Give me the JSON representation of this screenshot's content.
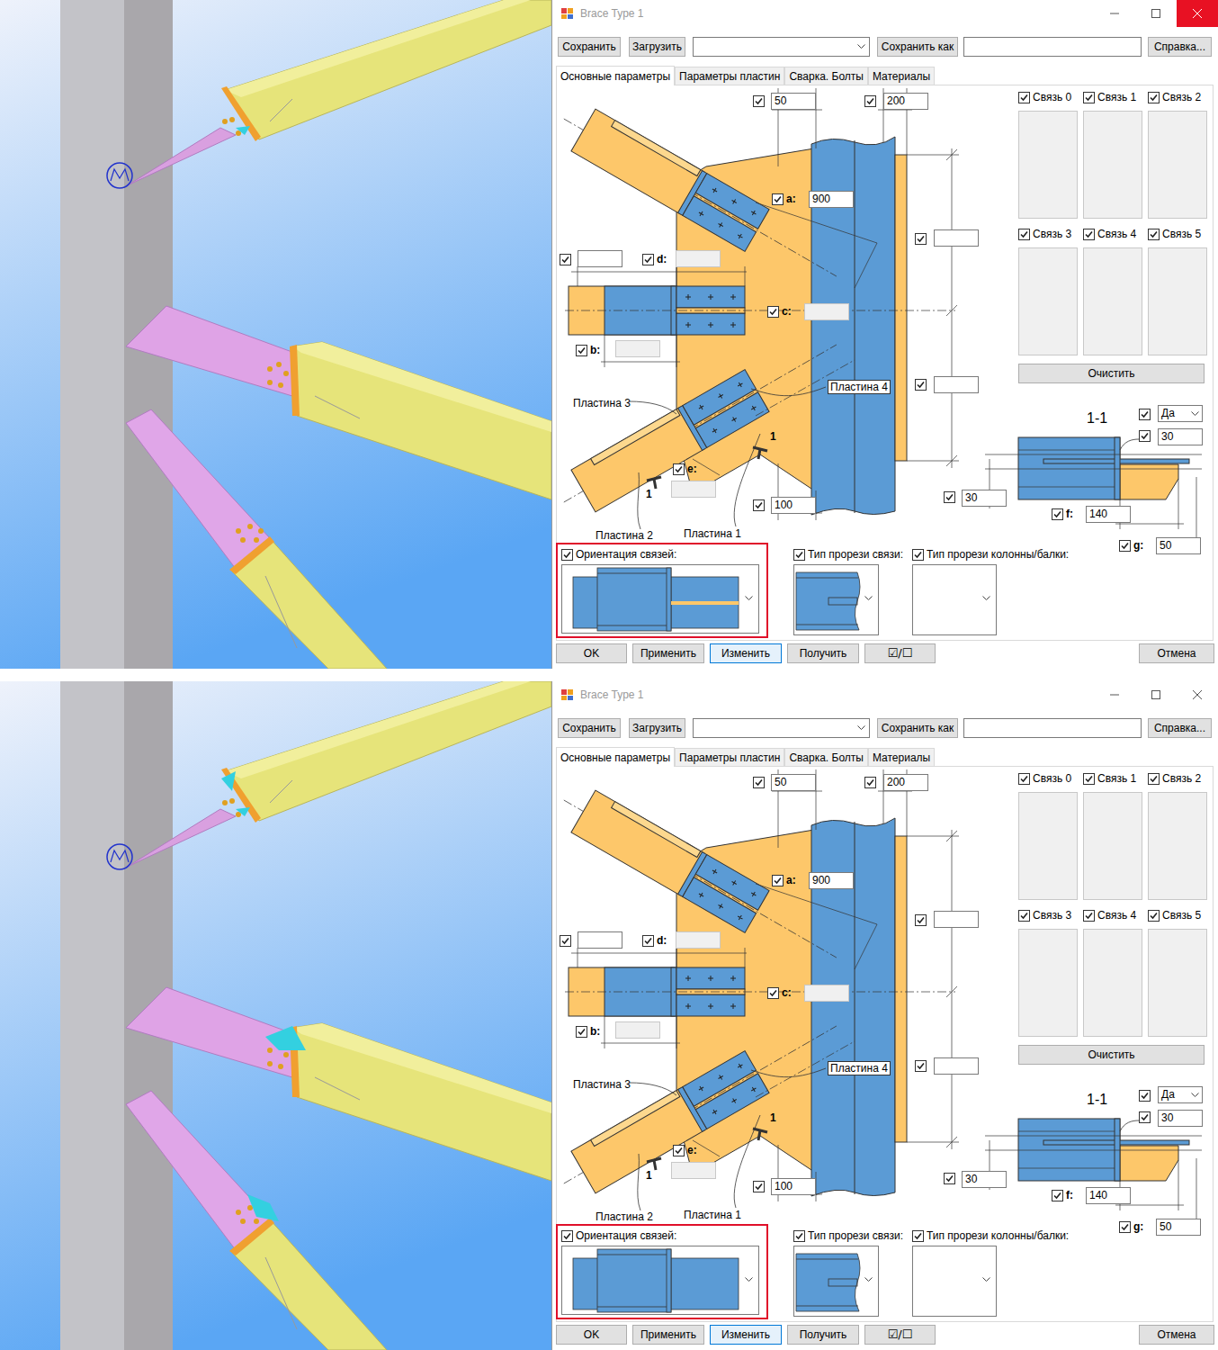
{
  "panels": [
    {
      "window": {
        "title": "Brace Type 1",
        "close_hovered": true
      },
      "toolbar": {
        "save": "Сохранить",
        "load": "Загрузить",
        "preset": "",
        "save_as": "Сохранить как",
        "save_as_name": "",
        "help": "Справка..."
      },
      "tabs": [
        {
          "label": "Основные параметры",
          "selected": true
        },
        {
          "label": "Параметры пластин",
          "selected": false
        },
        {
          "label": "Сварка. Болты",
          "selected": false
        },
        {
          "label": "Материалы",
          "selected": false
        }
      ],
      "fields": [
        {
          "value": "50",
          "checked": true,
          "disabled": false,
          "kind": "input"
        },
        {
          "value": "200",
          "checked": true,
          "disabled": false,
          "kind": "input"
        },
        {
          "label": "a:",
          "value": "900",
          "checked": true,
          "disabled": false,
          "kind": "input"
        },
        {
          "value": "",
          "checked": true,
          "disabled": false,
          "kind": "input"
        },
        {
          "value": "",
          "checked": true,
          "disabled": false,
          "kind": "input"
        },
        {
          "label": "d:",
          "value": "",
          "checked": true,
          "disabled": true,
          "kind": "input"
        },
        {
          "label": "c:",
          "value": "",
          "checked": true,
          "disabled": true,
          "kind": "input"
        },
        {
          "label": "b:",
          "value": "",
          "checked": true,
          "disabled": true,
          "kind": "input"
        },
        {
          "value": "",
          "checked": true,
          "disabled": false,
          "kind": "input"
        },
        {
          "label": "e:",
          "value": "",
          "checked": true,
          "disabled": true,
          "kind": "input"
        },
        {
          "value": "100",
          "checked": true,
          "disabled": false,
          "kind": "input"
        },
        {
          "value": "Да",
          "checked": true,
          "disabled": false,
          "kind": "dropdown"
        },
        {
          "value": "30",
          "checked": true,
          "disabled": false,
          "kind": "input"
        },
        {
          "value": "30",
          "checked": true,
          "disabled": false,
          "kind": "input"
        },
        {
          "label": "f:",
          "value": "140",
          "checked": true,
          "disabled": false,
          "kind": "input"
        },
        {
          "label": "g:",
          "value": "50",
          "checked": true,
          "disabled": false,
          "kind": "input"
        }
      ],
      "plates": [
        "Пластина 3",
        "Пластина 4",
        "Пластина 2",
        "Пластина 1"
      ],
      "section_marks": [
        "1",
        "1"
      ],
      "section_title": "1-1",
      "links": [
        {
          "label": "Связь 0",
          "checked": true
        },
        {
          "label": "Связь 1",
          "checked": true
        },
        {
          "label": "Связь 2",
          "checked": true
        },
        {
          "label": "Связь 3",
          "checked": true
        },
        {
          "label": "Связь 4",
          "checked": true
        },
        {
          "label": "Связь 5",
          "checked": true
        }
      ],
      "clear_button": "Очистить",
      "options": [
        {
          "label": "Ориентация связей:",
          "checked": true,
          "highlighted": true,
          "kind": "orientation"
        },
        {
          "label": "Тип прорези связи:",
          "checked": true,
          "highlighted": false,
          "kind": "brace-slot"
        },
        {
          "label": "Тип прорези колонны/балки:",
          "checked": true,
          "highlighted": false,
          "kind": "column-slot"
        }
      ],
      "orientation_plate_visible": true,
      "view": {
        "cut_pieces_visible": false
      },
      "buttons": [
        {
          "label": "OK",
          "focused": false
        },
        {
          "label": "Применить",
          "focused": false
        },
        {
          "label": "Изменить",
          "focused": true
        },
        {
          "label": "Получить",
          "focused": false
        },
        {
          "label": "☑/☐",
          "focused": false
        },
        {
          "label": "Отмена",
          "focused": false
        }
      ]
    },
    {
      "window": {
        "title": "Brace Type 1",
        "close_hovered": false
      },
      "toolbar": {
        "save": "Сохранить",
        "load": "Загрузить",
        "preset": "",
        "save_as": "Сохранить как",
        "save_as_name": "",
        "help": "Справка..."
      },
      "tabs": [
        {
          "label": "Основные параметры",
          "selected": true
        },
        {
          "label": "Параметры пластин",
          "selected": false
        },
        {
          "label": "Сварка. Болты",
          "selected": false
        },
        {
          "label": "Материалы",
          "selected": false
        }
      ],
      "fields": [
        {
          "value": "50",
          "checked": true,
          "disabled": false,
          "kind": "input"
        },
        {
          "value": "200",
          "checked": true,
          "disabled": false,
          "kind": "input"
        },
        {
          "label": "a:",
          "value": "900",
          "checked": true,
          "disabled": false,
          "kind": "input"
        },
        {
          "value": "",
          "checked": true,
          "disabled": false,
          "kind": "input"
        },
        {
          "value": "",
          "checked": true,
          "disabled": false,
          "kind": "input"
        },
        {
          "label": "d:",
          "value": "",
          "checked": true,
          "disabled": true,
          "kind": "input"
        },
        {
          "label": "c:",
          "value": "",
          "checked": true,
          "disabled": true,
          "kind": "input"
        },
        {
          "label": "b:",
          "value": "",
          "checked": true,
          "disabled": true,
          "kind": "input"
        },
        {
          "value": "",
          "checked": true,
          "disabled": false,
          "kind": "input"
        },
        {
          "label": "e:",
          "value": "",
          "checked": true,
          "disabled": true,
          "kind": "input"
        },
        {
          "value": "100",
          "checked": true,
          "disabled": false,
          "kind": "input"
        },
        {
          "value": "Да",
          "checked": true,
          "disabled": false,
          "kind": "dropdown"
        },
        {
          "value": "30",
          "checked": true,
          "disabled": false,
          "kind": "input"
        },
        {
          "value": "30",
          "checked": true,
          "disabled": false,
          "kind": "input"
        },
        {
          "label": "f:",
          "value": "140",
          "checked": true,
          "disabled": false,
          "kind": "input"
        },
        {
          "label": "g:",
          "value": "50",
          "checked": true,
          "disabled": false,
          "kind": "input"
        }
      ],
      "plates": [
        "Пластина 3",
        "Пластина 4",
        "Пластина 2",
        "Пластина 1"
      ],
      "section_marks": [
        "1",
        "1"
      ],
      "section_title": "1-1",
      "links": [
        {
          "label": "Связь 0",
          "checked": true
        },
        {
          "label": "Связь 1",
          "checked": true
        },
        {
          "label": "Связь 2",
          "checked": true
        },
        {
          "label": "Связь 3",
          "checked": true
        },
        {
          "label": "Связь 4",
          "checked": true
        },
        {
          "label": "Связь 5",
          "checked": true
        }
      ],
      "clear_button": "Очистить",
      "options": [
        {
          "label": "Ориентация связей:",
          "checked": true,
          "highlighted": true,
          "kind": "orientation"
        },
        {
          "label": "Тип прорези связи:",
          "checked": true,
          "highlighted": false,
          "kind": "brace-slot"
        },
        {
          "label": "Тип прорези колонны/балки:",
          "checked": true,
          "highlighted": false,
          "kind": "column-slot"
        }
      ],
      "orientation_plate_visible": false,
      "view": {
        "cut_pieces_visible": true
      },
      "buttons": [
        {
          "label": "OK",
          "focused": false
        },
        {
          "label": "Применить",
          "focused": false
        },
        {
          "label": "Изменить",
          "focused": true
        },
        {
          "label": "Получить",
          "focused": false
        },
        {
          "label": "☑/☐",
          "focused": false
        },
        {
          "label": "Отмена",
          "focused": false
        }
      ]
    }
  ]
}
